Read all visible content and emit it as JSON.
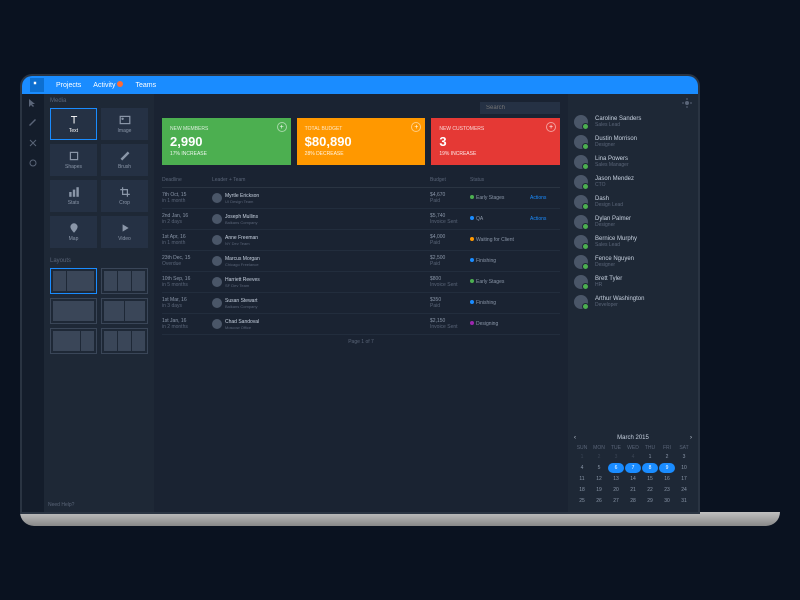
{
  "nav": {
    "items": [
      "Projects",
      "Activity",
      "Teams"
    ]
  },
  "tools": {
    "section": "Media",
    "items": [
      {
        "name": "Text",
        "icon": "T"
      },
      {
        "name": "Image",
        "icon": "img"
      },
      {
        "name": "Shapes",
        "icon": "sq"
      },
      {
        "name": "Brush",
        "icon": "brush"
      },
      {
        "name": "Stats",
        "icon": "bars"
      },
      {
        "name": "Crop",
        "icon": "crop"
      },
      {
        "name": "Map",
        "icon": "pin"
      },
      {
        "name": "Video",
        "icon": "play"
      }
    ],
    "layouts_label": "Layouts",
    "help": "Need Help?"
  },
  "search": {
    "placeholder": "Search"
  },
  "cards": [
    {
      "label": "NEW MEMBERS",
      "value": "2,990",
      "sub": "17% INCREASE",
      "color": "green"
    },
    {
      "label": "TOTAL BUDGET",
      "value": "$80,890",
      "sub": "28% DECREASE",
      "color": "orange"
    },
    {
      "label": "NEW CUSTOMERS",
      "value": "3",
      "sub": "19% INCREASE",
      "color": "red"
    }
  ],
  "table": {
    "cols": [
      "Deadline",
      "Leader + Team",
      "Budget",
      "Status",
      ""
    ],
    "rows": [
      {
        "date": "7th Oct, 15",
        "sub": "in 1 month",
        "name": "Myrtle Erickson",
        "team": "UI Design Team",
        "budget": "$4,670",
        "bsub": "Paid",
        "status": "Early Stages",
        "dot": "g",
        "action": "Actions"
      },
      {
        "date": "2nd Jan, 16",
        "sub": "in 2 days",
        "name": "Joseph Mullins",
        "team": "Balkans Company",
        "budget": "$5,740",
        "bsub": "Invoice Sent",
        "status": "QA",
        "dot": "b",
        "action": "Actions"
      },
      {
        "date": "1st Apr, 16",
        "sub": "in 1 month",
        "name": "Anne Freeman",
        "team": "NY Dev Team",
        "budget": "$4,000",
        "bsub": "Paid",
        "status": "Waiting for Client",
        "dot": "y",
        "action": ""
      },
      {
        "date": "23th Dec, 15",
        "sub": "Overdue",
        "name": "Marcus Morgan",
        "team": "Chicago Freelance",
        "budget": "$2,500",
        "bsub": "Paid",
        "status": "Finishing",
        "dot": "b",
        "action": ""
      },
      {
        "date": "10th Sep, 16",
        "sub": "in 5 months",
        "name": "Harriett Reeves",
        "team": "SF Dev Team",
        "budget": "$800",
        "bsub": "Invoice Sent",
        "status": "Early Stages",
        "dot": "g",
        "action": ""
      },
      {
        "date": "1st Mar, 16",
        "sub": "in 3 days",
        "name": "Susan Stewart",
        "team": "Balkans Company",
        "budget": "$350",
        "bsub": "Paid",
        "status": "Finishing",
        "dot": "b",
        "action": ""
      },
      {
        "date": "1st Jan, 16",
        "sub": "in 2 months",
        "name": "Chad Sandoval",
        "team": "Moscow Office",
        "budget": "$2,150",
        "bsub": "Invoice Sent",
        "status": "Designing",
        "dot": "p",
        "action": ""
      }
    ],
    "pager": "Page 1 of 7"
  },
  "team": [
    {
      "name": "Caroline Sanders",
      "role": "Sales Lead"
    },
    {
      "name": "Dustin Morrison",
      "role": "Designer"
    },
    {
      "name": "Lina Powers",
      "role": "Sales Manager"
    },
    {
      "name": "Jason Mendez",
      "role": "CTO"
    },
    {
      "name": "Dash",
      "role": "Design Lead"
    },
    {
      "name": "Dylan Palmer",
      "role": "Designer"
    },
    {
      "name": "Bernice Murphy",
      "role": "Sales Lead"
    },
    {
      "name": "Fence Nguyen",
      "role": "Designer"
    },
    {
      "name": "Brett Tyler",
      "role": "HR"
    },
    {
      "name": "Arthur Washington",
      "role": "Developer"
    }
  ],
  "calendar": {
    "title": "March 2015",
    "dow": [
      "SUN",
      "MON",
      "TUE",
      "WED",
      "THU",
      "FRI",
      "SAT"
    ],
    "days": [
      {
        "n": 1,
        "o": true
      },
      {
        "n": 2,
        "o": true
      },
      {
        "n": 3,
        "o": true
      },
      {
        "n": 4,
        "o": true
      },
      {
        "n": 1
      },
      {
        "n": 2
      },
      {
        "n": 3
      },
      {
        "n": 4
      },
      {
        "n": 5
      },
      {
        "n": 6,
        "s": true
      },
      {
        "n": 7,
        "s": true
      },
      {
        "n": 8,
        "s": true
      },
      {
        "n": 9,
        "s": true
      },
      {
        "n": 10
      },
      {
        "n": 11
      },
      {
        "n": 12
      },
      {
        "n": 13
      },
      {
        "n": 14
      },
      {
        "n": 15
      },
      {
        "n": 16
      },
      {
        "n": 17
      },
      {
        "n": 18
      },
      {
        "n": 19
      },
      {
        "n": 20
      },
      {
        "n": 21
      },
      {
        "n": 22
      },
      {
        "n": 23
      },
      {
        "n": 24
      },
      {
        "n": 25
      },
      {
        "n": 26
      },
      {
        "n": 27
      },
      {
        "n": 28
      },
      {
        "n": 29
      },
      {
        "n": 30
      },
      {
        "n": 31
      }
    ]
  }
}
